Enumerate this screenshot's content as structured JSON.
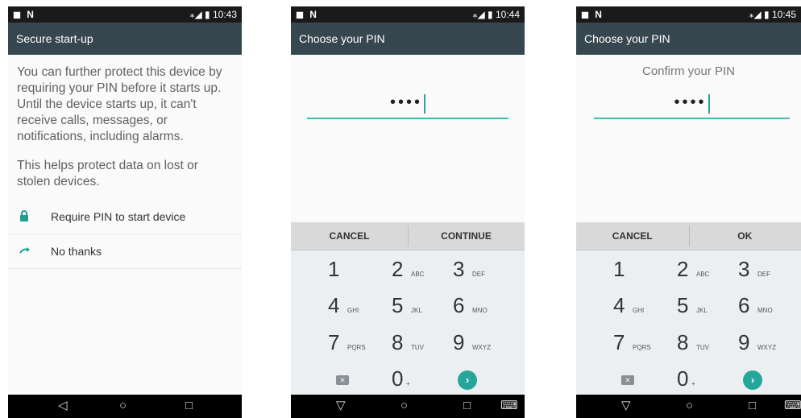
{
  "screen1": {
    "status": {
      "left": "◼ N",
      "right": "⁎◢ ▮ 10:43"
    },
    "title": "Secure start-up",
    "para1": "You can further protect this device by requiring your PIN before it starts up. Until the device starts up, it can't receive calls, messages, or notifications, including alarms.",
    "para2": "This helps protect data on lost or stolen devices.",
    "options": [
      {
        "icon": "lock-icon",
        "label": "Require PIN to start device"
      },
      {
        "icon": "arrow-icon",
        "label": "No thanks"
      }
    ],
    "nav": {
      "back": "◁",
      "home": "○",
      "recents": "□"
    }
  },
  "screen2": {
    "status": {
      "left": "◼ N",
      "right": "⁎◢ ▮ 10:44"
    },
    "title": "Choose your PIN",
    "heading": "",
    "pin": "••••",
    "cancel": "CANCEL",
    "confirm": "CONTINUE",
    "nav": {
      "back": "▽",
      "home": "○",
      "recents": "□",
      "keyboard": "⌨"
    }
  },
  "screen3": {
    "status": {
      "left": "◼ N",
      "right": "⁎◢ ▮ 10:45"
    },
    "title": "Choose your PIN",
    "heading": "Confirm your PIN",
    "pin": "••••",
    "cancel": "CANCEL",
    "confirm": "OK",
    "nav": {
      "back": "▽",
      "home": "○",
      "recents": "□",
      "keyboard": "⌨"
    }
  },
  "keypad": {
    "keys": [
      {
        "digit": "1",
        "letters": ""
      },
      {
        "digit": "2",
        "letters": "ABC"
      },
      {
        "digit": "3",
        "letters": "DEF"
      },
      {
        "digit": "4",
        "letters": "GHI"
      },
      {
        "digit": "5",
        "letters": "JKL"
      },
      {
        "digit": "6",
        "letters": "MNO"
      },
      {
        "digit": "7",
        "letters": "PQRS"
      },
      {
        "digit": "8",
        "letters": "TUV"
      },
      {
        "digit": "9",
        "letters": "WXYZ"
      },
      {
        "digit": "0",
        "letters": "+"
      }
    ],
    "delete_glyph": "✕",
    "go_glyph": "›"
  },
  "colors": {
    "accent": "#26a69a",
    "appbar": "#37474f",
    "keypad_bg": "#eceff1",
    "actionbar": "#d9d9d9"
  }
}
